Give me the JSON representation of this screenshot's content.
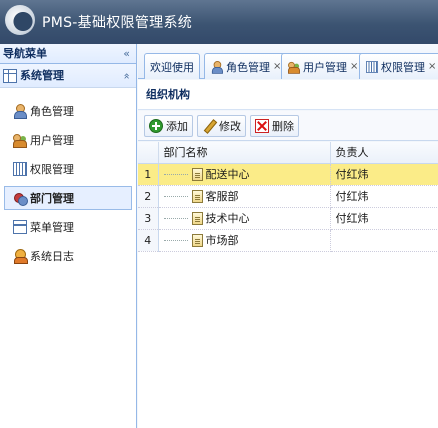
{
  "app": {
    "title": "PMS-基础权限管理系统"
  },
  "sidebar": {
    "nav_title": "导航菜单",
    "nav_collapse": "«",
    "section_title": "系统管理",
    "section_toggle": "«",
    "items": [
      {
        "label": "角色管理",
        "icon": "role-icon"
      },
      {
        "label": "用户管理",
        "icon": "users-icon"
      },
      {
        "label": "权限管理",
        "icon": "permission-icon"
      },
      {
        "label": "部门管理",
        "icon": "department-icon",
        "active": true
      },
      {
        "label": "菜单管理",
        "icon": "menu-icon"
      },
      {
        "label": "系统日志",
        "icon": "log-icon"
      }
    ]
  },
  "tabs": [
    {
      "label": "欢迎使用"
    },
    {
      "label": "角色管理",
      "close": "×"
    },
    {
      "label": "用户管理",
      "close": "×"
    },
    {
      "label": "权限管理",
      "close": "×"
    }
  ],
  "panel": {
    "title": "组织机构"
  },
  "toolbar": {
    "add": "添加",
    "edit": "修改",
    "delete": "删除"
  },
  "grid": {
    "columns": [
      "部门名称",
      "负责人"
    ],
    "rows": [
      {
        "num": "1",
        "name": "配送中心",
        "manager": "付红炜",
        "selected": true
      },
      {
        "num": "2",
        "name": "客服部",
        "manager": "付红炜"
      },
      {
        "num": "3",
        "name": "技术中心",
        "manager": "付红炜"
      },
      {
        "num": "4",
        "name": "市场部",
        "manager": ""
      }
    ]
  },
  "colors": {
    "header_bg": "#3c5472",
    "selected_row": "#fbec88",
    "border": "#95b8e7"
  }
}
